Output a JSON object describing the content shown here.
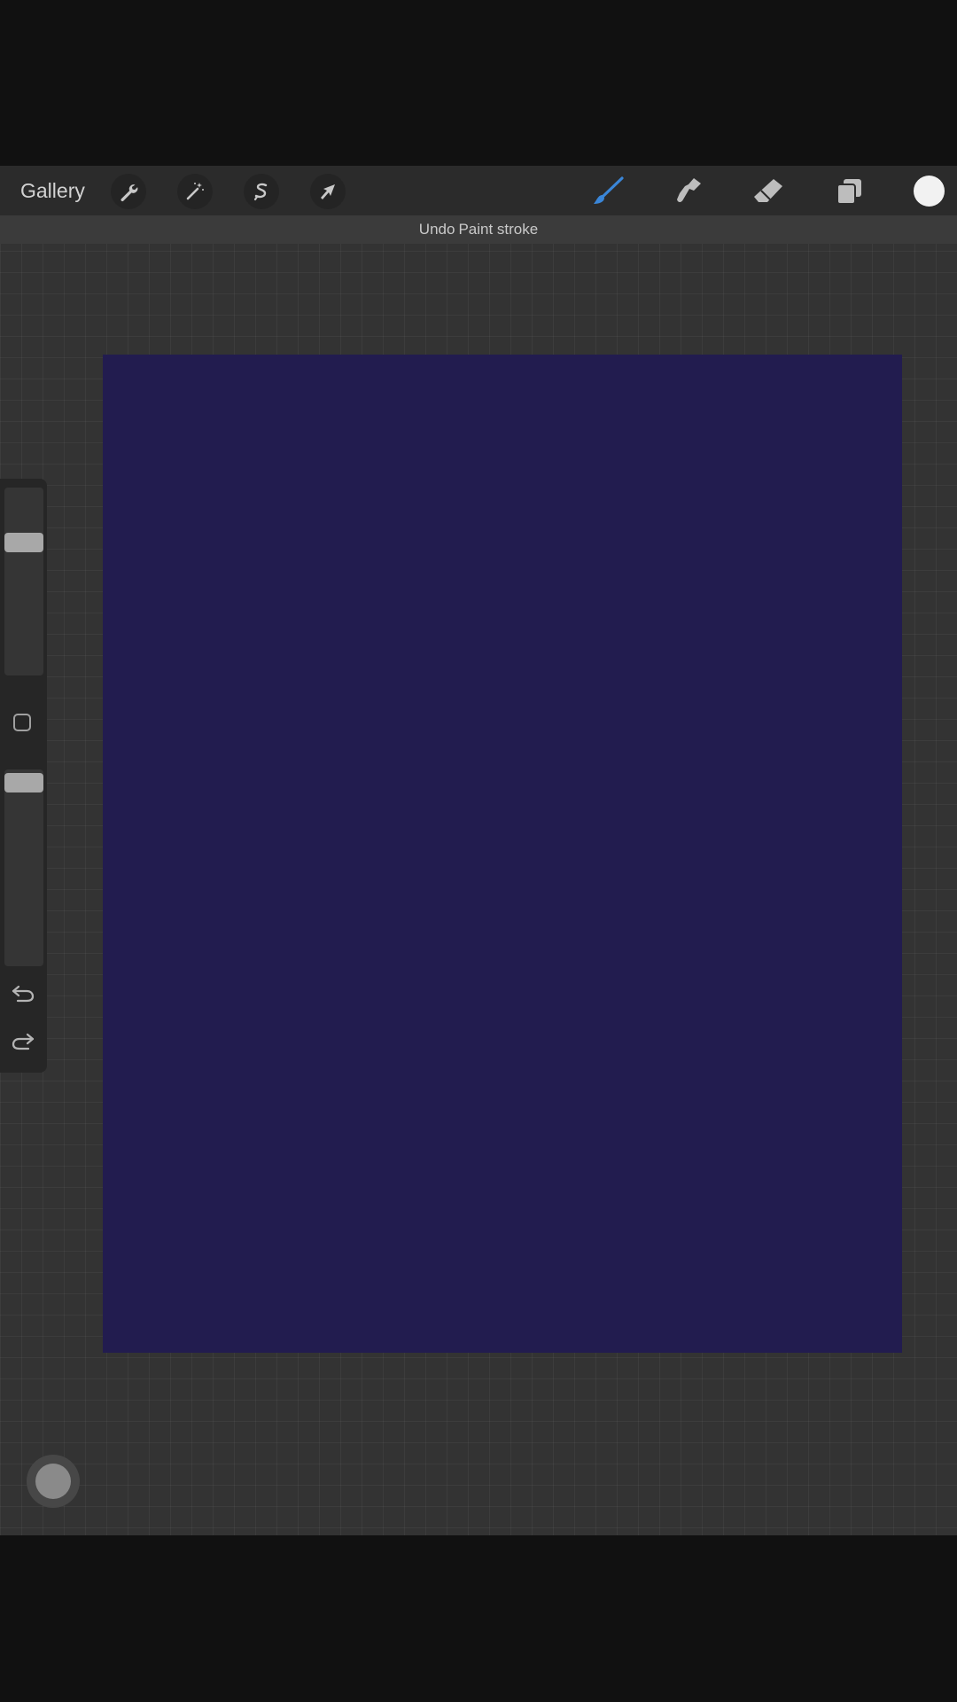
{
  "toolbar": {
    "gallery_label": "Gallery",
    "left_tools": [
      {
        "icon": "wrench-icon",
        "name": "actions"
      },
      {
        "icon": "magic-wand-icon",
        "name": "adjustments"
      },
      {
        "icon": "selection-icon",
        "name": "selection"
      },
      {
        "icon": "transform-arrow-icon",
        "name": "transform"
      }
    ],
    "right_tools": [
      {
        "icon": "paintbrush-icon",
        "name": "paint",
        "active": true
      },
      {
        "icon": "smudge-icon",
        "name": "smudge",
        "active": false
      },
      {
        "icon": "eraser-icon",
        "name": "eraser",
        "active": false
      },
      {
        "icon": "layers-icon",
        "name": "layers",
        "active": false
      }
    ],
    "current_color": "#f2f2f2"
  },
  "banner": {
    "action": "Undo",
    "detail": "Paint stroke"
  },
  "canvas": {
    "fill_color": "#221c4f"
  },
  "sidebar": {
    "brush_size_icon": "brush-size-slider",
    "opacity_icon": "opacity-slider",
    "modify_icon": "square-modify-icon",
    "undo_icon": "undo-arrow-icon",
    "redo_icon": "redo-arrow-icon"
  },
  "colors": {
    "accent": "#3a86d8",
    "background": "#333333",
    "toolbar": "#2b2b2b"
  }
}
